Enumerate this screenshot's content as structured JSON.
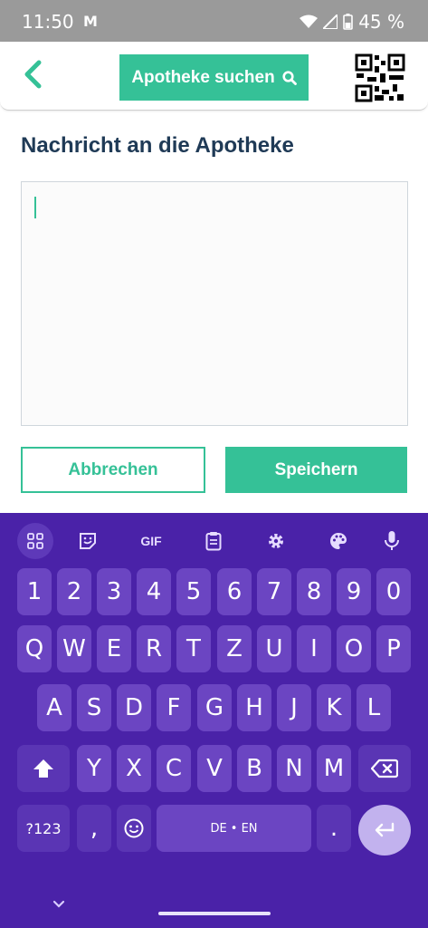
{
  "status_bar": {
    "time": "11:50",
    "gmail_label": "M",
    "battery": "45 %"
  },
  "header": {
    "search_label": "Apotheke suchen"
  },
  "page": {
    "title": "Nachricht an die Apotheke"
  },
  "message": {
    "value": ""
  },
  "actions": {
    "cancel_label": "Abbrechen",
    "save_label": "Speichern"
  },
  "keyboard": {
    "tools": {
      "gif": "GIF"
    },
    "number_row": [
      "1",
      "2",
      "3",
      "4",
      "5",
      "6",
      "7",
      "8",
      "9",
      "0"
    ],
    "row1": [
      "Q",
      "W",
      "E",
      "R",
      "T",
      "Z",
      "U",
      "I",
      "O",
      "P"
    ],
    "row2": [
      "A",
      "S",
      "D",
      "F",
      "G",
      "H",
      "J",
      "K",
      "L"
    ],
    "row3": [
      "Y",
      "X",
      "C",
      "V",
      "B",
      "N",
      "M"
    ],
    "symbols_label": "?123",
    "comma": ",",
    "space_label": "DE • EN",
    "period": "."
  },
  "colors": {
    "accent": "#35c197",
    "title": "#1f3a56",
    "keyboard_bg": "#4a22a8",
    "key": "#6b45c2"
  }
}
